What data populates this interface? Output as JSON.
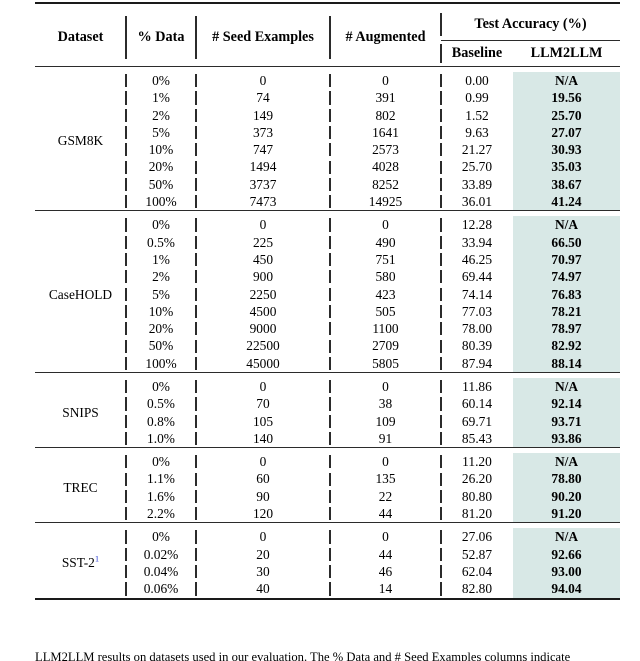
{
  "table": {
    "headers": {
      "dataset": "Dataset",
      "pct_data": "% Data",
      "seed_examples": "# Seed Examples",
      "augmented": "# Augmented",
      "test_accuracy": "Test Accuracy (%)",
      "baseline": "Baseline",
      "llm2llm": "LLM2LLM"
    },
    "highlight_color": "#d8e8e6",
    "footnote_marker": "1",
    "groups": [
      {
        "name": "GSM8K",
        "footnote": "",
        "rows": [
          {
            "pct": "0%",
            "seed": "0",
            "aug": "0",
            "baseline": "0.00",
            "llm2llm": "N/A"
          },
          {
            "pct": "1%",
            "seed": "74",
            "aug": "391",
            "baseline": "0.99",
            "llm2llm": "19.56"
          },
          {
            "pct": "2%",
            "seed": "149",
            "aug": "802",
            "baseline": "1.52",
            "llm2llm": "25.70"
          },
          {
            "pct": "5%",
            "seed": "373",
            "aug": "1641",
            "baseline": "9.63",
            "llm2llm": "27.07"
          },
          {
            "pct": "10%",
            "seed": "747",
            "aug": "2573",
            "baseline": "21.27",
            "llm2llm": "30.93"
          },
          {
            "pct": "20%",
            "seed": "1494",
            "aug": "4028",
            "baseline": "25.70",
            "llm2llm": "35.03"
          },
          {
            "pct": "50%",
            "seed": "3737",
            "aug": "8252",
            "baseline": "33.89",
            "llm2llm": "38.67"
          },
          {
            "pct": "100%",
            "seed": "7473",
            "aug": "14925",
            "baseline": "36.01",
            "llm2llm": "41.24"
          }
        ]
      },
      {
        "name": "CaseHOLD",
        "footnote": "",
        "rows": [
          {
            "pct": "0%",
            "seed": "0",
            "aug": "0",
            "baseline": "12.28",
            "llm2llm": "N/A"
          },
          {
            "pct": "0.5%",
            "seed": "225",
            "aug": "490",
            "baseline": "33.94",
            "llm2llm": "66.50"
          },
          {
            "pct": "1%",
            "seed": "450",
            "aug": "751",
            "baseline": "46.25",
            "llm2llm": "70.97"
          },
          {
            "pct": "2%",
            "seed": "900",
            "aug": "580",
            "baseline": "69.44",
            "llm2llm": "74.97"
          },
          {
            "pct": "5%",
            "seed": "2250",
            "aug": "423",
            "baseline": "74.14",
            "llm2llm": "76.83"
          },
          {
            "pct": "10%",
            "seed": "4500",
            "aug": "505",
            "baseline": "77.03",
            "llm2llm": "78.21"
          },
          {
            "pct": "20%",
            "seed": "9000",
            "aug": "1100",
            "baseline": "78.00",
            "llm2llm": "78.97"
          },
          {
            "pct": "50%",
            "seed": "22500",
            "aug": "2709",
            "baseline": "80.39",
            "llm2llm": "82.92"
          },
          {
            "pct": "100%",
            "seed": "45000",
            "aug": "5805",
            "baseline": "87.94",
            "llm2llm": "88.14"
          }
        ]
      },
      {
        "name": "SNIPS",
        "footnote": "",
        "rows": [
          {
            "pct": "0%",
            "seed": "0",
            "aug": "0",
            "baseline": "11.86",
            "llm2llm": "N/A"
          },
          {
            "pct": "0.5%",
            "seed": "70",
            "aug": "38",
            "baseline": "60.14",
            "llm2llm": "92.14"
          },
          {
            "pct": "0.8%",
            "seed": "105",
            "aug": "109",
            "baseline": "69.71",
            "llm2llm": "93.71"
          },
          {
            "pct": "1.0%",
            "seed": "140",
            "aug": "91",
            "baseline": "85.43",
            "llm2llm": "93.86"
          }
        ]
      },
      {
        "name": "TREC",
        "footnote": "",
        "rows": [
          {
            "pct": "0%",
            "seed": "0",
            "aug": "0",
            "baseline": "11.20",
            "llm2llm": "N/A"
          },
          {
            "pct": "1.1%",
            "seed": "60",
            "aug": "135",
            "baseline": "26.20",
            "llm2llm": "78.80"
          },
          {
            "pct": "1.6%",
            "seed": "90",
            "aug": "22",
            "baseline": "80.80",
            "llm2llm": "90.20"
          },
          {
            "pct": "2.2%",
            "seed": "120",
            "aug": "44",
            "baseline": "81.20",
            "llm2llm": "91.20"
          }
        ]
      },
      {
        "name": "SST-2",
        "footnote": "1",
        "rows": [
          {
            "pct": "0%",
            "seed": "0",
            "aug": "0",
            "baseline": "27.06",
            "llm2llm": "N/A"
          },
          {
            "pct": "0.02%",
            "seed": "20",
            "aug": "44",
            "baseline": "52.87",
            "llm2llm": "92.66"
          },
          {
            "pct": "0.04%",
            "seed": "30",
            "aug": "46",
            "baseline": "62.04",
            "llm2llm": "93.00"
          },
          {
            "pct": "0.06%",
            "seed": "40",
            "aug": "14",
            "baseline": "82.80",
            "llm2llm": "94.04"
          }
        ]
      }
    ]
  },
  "caption": {
    "text": "LLM2LLM results on datasets used in our evaluation. The % Data and # Seed Examples columns indicate"
  }
}
